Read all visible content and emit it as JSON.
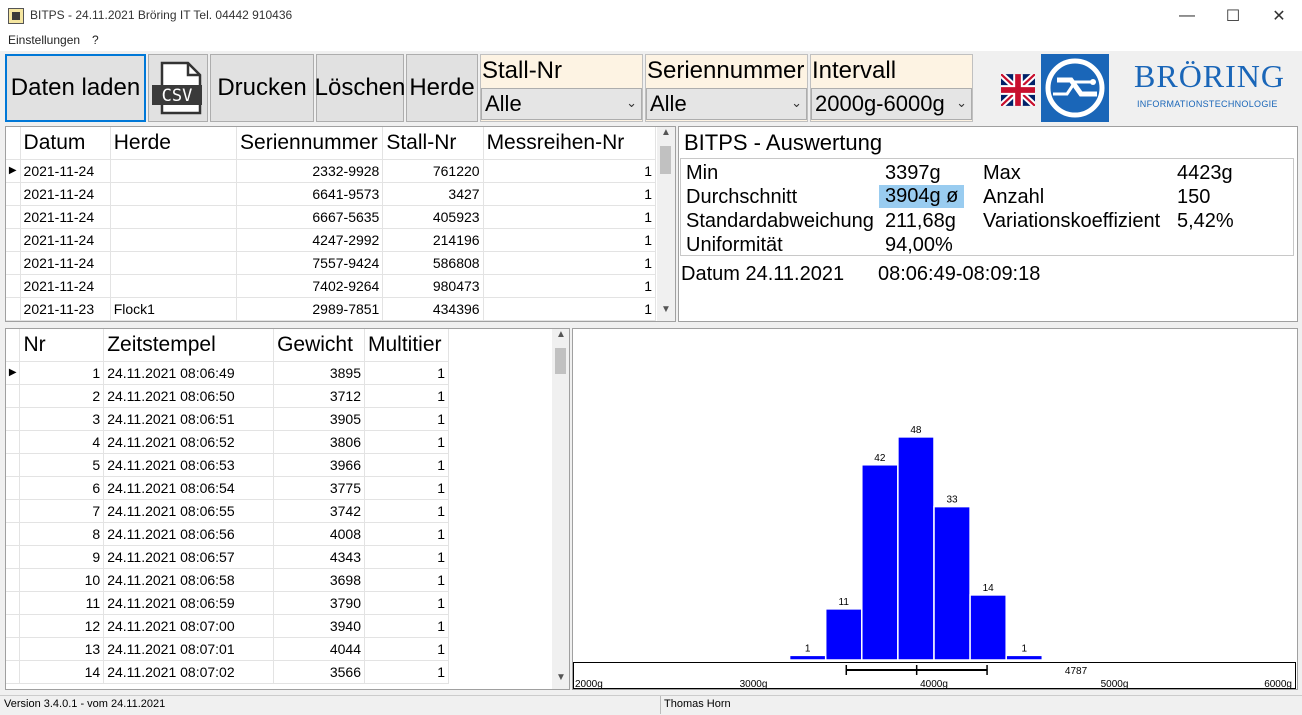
{
  "window": {
    "title": "BITPS - 24.11.2021 Bröring IT  Tel. 04442 910436",
    "minimize": "—",
    "maximize": "☐",
    "close": "✕"
  },
  "menu": [
    "Einstellungen",
    "?"
  ],
  "toolbar": {
    "load_label": "Daten laden",
    "csv_label": "CSV",
    "print_label": "Drucken",
    "delete_label": "Löschen",
    "herd_label": "Herde"
  },
  "filters": {
    "stall": {
      "label": "Stall-Nr",
      "value": "Alle"
    },
    "serie": {
      "label": "Seriennummer",
      "value": "Alle"
    },
    "interval": {
      "label": "Intervall",
      "value": "2000g-6000g"
    }
  },
  "brand": {
    "name": "BRÖRING",
    "tagline": "INFORMATIONSTECHNOLOGIE"
  },
  "series_table": {
    "headers": [
      "Datum",
      "Herde",
      "Seriennummer",
      "Stall-Nr",
      "Messreihen-Nr"
    ],
    "rows": [
      [
        "2021-11-24",
        "",
        "2332-9928",
        "761220",
        "1"
      ],
      [
        "2021-11-24",
        "",
        "6641-9573",
        "3427",
        "1"
      ],
      [
        "2021-11-24",
        "",
        "6667-5635",
        "405923",
        "1"
      ],
      [
        "2021-11-24",
        "",
        "4247-2992",
        "214196",
        "1"
      ],
      [
        "2021-11-24",
        "",
        "7557-9424",
        "586808",
        "1"
      ],
      [
        "2021-11-24",
        "",
        "7402-9264",
        "980473",
        "1"
      ],
      [
        "2021-11-23",
        "Flock1",
        "2989-7851",
        "434396",
        "1"
      ]
    ]
  },
  "analysis": {
    "title": "BITPS - Auswertung",
    "min_label": "Min",
    "min_value": "3397g",
    "max_label": "Max",
    "max_value": "4423g",
    "avg_label": "Durchschnitt",
    "avg_value": "3904g ø",
    "count_label": "Anzahl",
    "count_value": "150",
    "std_label": "Standardabweichung",
    "std_value": "211,68g",
    "cv_label": "Variationskoeffizient",
    "cv_value": "5,42%",
    "uni_label": "Uniformität",
    "uni_value": "94,00%",
    "date_label": "Datum 24.11.2021",
    "time_range": "08:06:49-08:09:18"
  },
  "measure_table": {
    "headers": [
      "Nr",
      "Zeitstempel",
      "Gewicht",
      "Multitier"
    ],
    "rows": [
      [
        "1",
        "24.11.2021 08:06:49",
        "3895",
        "1"
      ],
      [
        "2",
        "24.11.2021 08:06:50",
        "3712",
        "1"
      ],
      [
        "3",
        "24.11.2021 08:06:51",
        "3905",
        "1"
      ],
      [
        "4",
        "24.11.2021 08:06:52",
        "3806",
        "1"
      ],
      [
        "5",
        "24.11.2021 08:06:53",
        "3966",
        "1"
      ],
      [
        "6",
        "24.11.2021 08:06:54",
        "3775",
        "1"
      ],
      [
        "7",
        "24.11.2021 08:06:55",
        "3742",
        "1"
      ],
      [
        "8",
        "24.11.2021 08:06:56",
        "4008",
        "1"
      ],
      [
        "9",
        "24.11.2021 08:06:57",
        "4343",
        "1"
      ],
      [
        "10",
        "24.11.2021 08:06:58",
        "3698",
        "1"
      ],
      [
        "11",
        "24.11.2021 08:06:59",
        "3790",
        "1"
      ],
      [
        "12",
        "24.11.2021 08:07:00",
        "3940",
        "1"
      ],
      [
        "13",
        "24.11.2021 08:07:01",
        "4044",
        "1"
      ],
      [
        "14",
        "24.11.2021 08:07:02",
        "3566",
        "1"
      ]
    ]
  },
  "chart_data": {
    "type": "bar",
    "title": "",
    "bin_width_g": 200,
    "bins": [
      {
        "x_start": 3200,
        "value": 1
      },
      {
        "x_start": 3400,
        "value": 11
      },
      {
        "x_start": 3600,
        "value": 42
      },
      {
        "x_start": 3800,
        "value": 48
      },
      {
        "x_start": 4000,
        "value": 33
      },
      {
        "x_start": 4200,
        "value": 14
      },
      {
        "x_start": 4400,
        "value": 1
      }
    ],
    "xlim": [
      2000,
      6000
    ],
    "ylim": [
      0,
      54
    ],
    "x_ticks": [
      "2000g",
      "3000g",
      "4000g",
      "5000g",
      "6000g"
    ],
    "x_tick_values": [
      2000,
      3000,
      4000,
      5000,
      6000
    ],
    "range_bar": {
      "min": 3514,
      "mean": 3904,
      "max": 4294
    },
    "max_marker_label": "4787",
    "max_marker_value": 4787,
    "bar_color": "#0000ff"
  },
  "status": {
    "version": "Version 3.4.0.1 - vom 24.11.2021",
    "user": "Thomas Horn"
  }
}
